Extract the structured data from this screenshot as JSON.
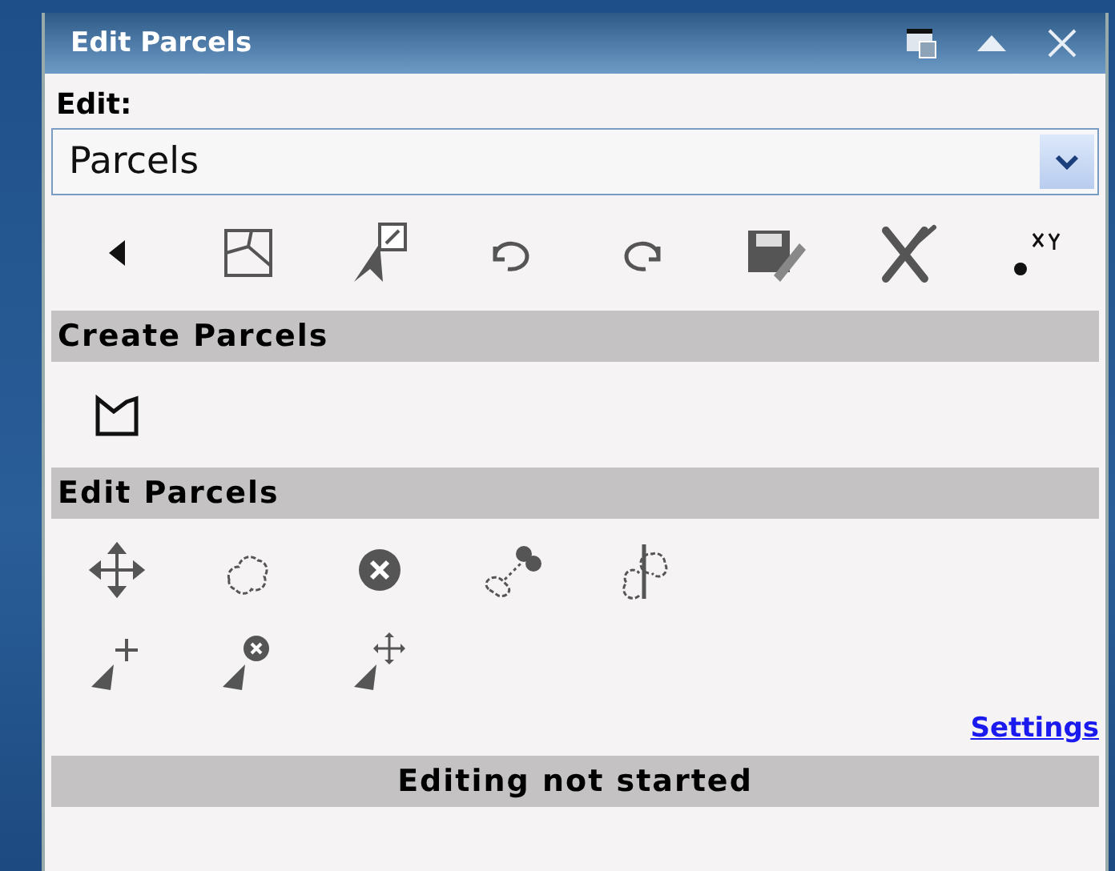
{
  "window": {
    "title": "Edit Parcels"
  },
  "edit_label": "Edit:",
  "layer_select": {
    "value": "Parcels"
  },
  "sections": [
    {
      "title": "Create Parcels"
    },
    {
      "title": "Edit Parcels"
    }
  ],
  "settings_link": "Settings",
  "status_bar": "Editing not started"
}
